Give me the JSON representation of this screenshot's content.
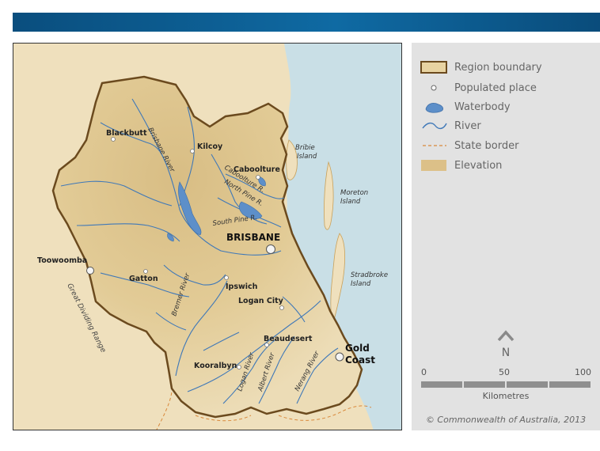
{
  "map": {
    "places": [
      {
        "id": "blackbutt",
        "name": "Blackbutt"
      },
      {
        "id": "kilcoy",
        "name": "Kilcoy"
      },
      {
        "id": "caboolture",
        "name": "Caboolture"
      },
      {
        "id": "brisbane",
        "name": "BRISBANE"
      },
      {
        "id": "toowoomba",
        "name": "Toowoomba"
      },
      {
        "id": "gatton",
        "name": "Gatton"
      },
      {
        "id": "ipswich",
        "name": "Ipswich"
      },
      {
        "id": "logan_city",
        "name": "Logan City"
      },
      {
        "id": "beaudesert",
        "name": "Beaudesert"
      },
      {
        "id": "kooralbyn",
        "name": "Kooralbyn"
      },
      {
        "id": "gold_coast_1",
        "name": "Gold"
      },
      {
        "id": "gold_coast_2",
        "name": "Coast"
      }
    ],
    "islands": [
      {
        "id": "bribie_1",
        "name": "Bribie"
      },
      {
        "id": "bribie_2",
        "name": "Island"
      },
      {
        "id": "moreton_1",
        "name": "Moreton"
      },
      {
        "id": "moreton_2",
        "name": "Island"
      },
      {
        "id": "stradbroke_1",
        "name": "Stradbroke"
      },
      {
        "id": "stradbroke_2",
        "name": "Island"
      }
    ],
    "rivers": [
      {
        "id": "brisbane_river",
        "name": "Brisbane River"
      },
      {
        "id": "caboolture_r",
        "name": "Caboolture R."
      },
      {
        "id": "north_pine_r",
        "name": "North Pine R."
      },
      {
        "id": "south_pine_r",
        "name": "South Pine R."
      },
      {
        "id": "bremer_river",
        "name": "Bremer River"
      },
      {
        "id": "logan_river",
        "name": "Logan River"
      },
      {
        "id": "albert_river",
        "name": "Albert River"
      },
      {
        "id": "nerang_river",
        "name": "Nerang River"
      }
    ],
    "range_label": "Great Dividing Range",
    "colors": {
      "ocean": "#c9dfe6",
      "land": "#efe0bd",
      "region": "#e4ce98",
      "region_boundary": "#6b4a1e",
      "river": "#3f78b8",
      "waterbody": "#5d8fc9",
      "state_border": "#d9893c"
    }
  },
  "legend": {
    "items": [
      {
        "label": "Region boundary",
        "icon": "region-boundary-swatch"
      },
      {
        "label": "Populated place",
        "icon": "populated-place-dot"
      },
      {
        "label": "Waterbody",
        "icon": "waterbody-swatch"
      },
      {
        "label": "River",
        "icon": "river-line"
      },
      {
        "label": "State border",
        "icon": "state-border-line"
      },
      {
        "label": "Elevation",
        "icon": "elevation-swatch"
      }
    ],
    "north_label": "N",
    "scale": {
      "ticks": [
        "0",
        "50",
        "100"
      ],
      "unit": "Kilometres"
    },
    "copyright": "© Commonwealth of Australia, 2013"
  }
}
